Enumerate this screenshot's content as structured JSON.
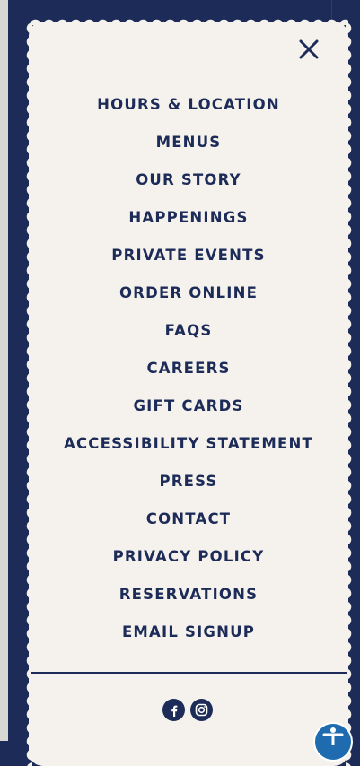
{
  "nav": {
    "items": [
      {
        "label": "HOURS & LOCATION"
      },
      {
        "label": "MENUS"
      },
      {
        "label": "OUR STORY"
      },
      {
        "label": "HAPPENINGS"
      },
      {
        "label": "PRIVATE EVENTS"
      },
      {
        "label": "ORDER ONLINE"
      },
      {
        "label": "FAQS"
      },
      {
        "label": "CAREERS"
      },
      {
        "label": "GIFT CARDS"
      },
      {
        "label": "ACCESSIBILITY STATEMENT"
      },
      {
        "label": "PRESS"
      },
      {
        "label": "CONTACT"
      },
      {
        "label": "PRIVACY POLICY"
      },
      {
        "label": "RESERVATIONS"
      },
      {
        "label": "EMAIL SIGNUP"
      }
    ]
  },
  "icons": {
    "close": "close-icon",
    "facebook": "facebook-icon",
    "instagram": "instagram-icon",
    "accessibility": "accessibility-icon"
  },
  "colors": {
    "navy": "#1c2b57",
    "cream": "#f5f2ed",
    "accessibility_blue": "#1e6bb0"
  }
}
